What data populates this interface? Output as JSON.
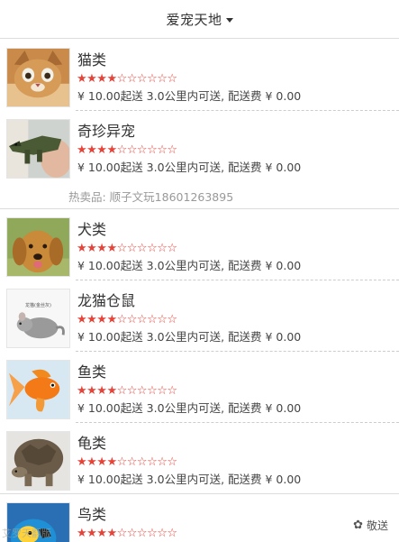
{
  "header": {
    "title": "爱宠天地"
  },
  "hot_label": "热卖品: 顺子文玩18601263895",
  "stars": {
    "filled": "★★★★",
    "empty": "☆☆☆☆☆☆",
    "rating": 4,
    "max": 10,
    "color": "#e64339"
  },
  "items": [
    {
      "name": "猫类",
      "meta": "¥ 10.00起送 3.0公里内可送, 配送费 ¥ 0.00",
      "thumb_icon": "cat-photo-icon"
    },
    {
      "name": "奇珍异宠",
      "meta": "¥ 10.00起送 3.0公里内可送, 配送费 ¥ 0.00",
      "thumb_icon": "crocodile-photo-icon"
    },
    {
      "name": "犬类",
      "meta": "¥ 10.00起送 3.0公里内可送, 配送费 ¥ 0.00",
      "thumb_icon": "dog-photo-icon"
    },
    {
      "name": "龙猫仓鼠",
      "meta": "¥ 10.00起送 3.0公里内可送, 配送费 ¥ 0.00",
      "thumb_icon": "chinchilla-photo-icon",
      "thumb_caption": "龙猫(金丝灰)"
    },
    {
      "name": "鱼类",
      "meta": "¥ 10.00起送 3.0公里内可送, 配送费 ¥ 0.00",
      "thumb_icon": "goldfish-photo-icon"
    },
    {
      "name": "龟类",
      "meta": "¥ 10.00起送 3.0公里内可送, 配送费 ¥ 0.00",
      "thumb_icon": "tortoise-photo-icon"
    },
    {
      "name": "鸟类",
      "meta": "",
      "thumb_icon": "parrot-photo-icon"
    }
  ],
  "footer": {
    "badge_label": "敬送",
    "badge_icon": "wechat-icon",
    "watermark": "艾罗天翻版"
  }
}
